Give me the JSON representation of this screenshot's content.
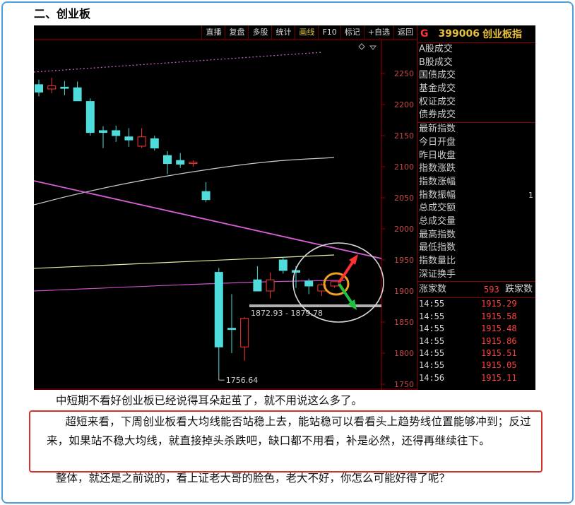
{
  "heading": "二、创业板",
  "toolbar": {
    "buttons": [
      "直播",
      "复盘",
      "多股",
      "统计",
      "画线",
      "F10",
      "标记",
      "+自选",
      "返回"
    ],
    "active": "画线"
  },
  "quote_panel": {
    "market_flag": "G",
    "code": "399006",
    "name": "创业板指",
    "group1": [
      "A股成交",
      "B股成交",
      "国债成交",
      "基金成交",
      "权证成交",
      "债券成交"
    ],
    "group2": [
      {
        "label": "最新指数",
        "value": ""
      },
      {
        "label": "今日开盘",
        "value": ""
      },
      {
        "label": "昨日收盘",
        "value": ""
      },
      {
        "label": "指数涨跌",
        "value": ""
      },
      {
        "label": "指数涨幅",
        "value": ""
      },
      {
        "label": "指数振幅",
        "value": "1"
      },
      {
        "label": "总成交额",
        "value": ""
      },
      {
        "label": "总成交量",
        "value": ""
      },
      {
        "label": "最高指数",
        "value": ""
      },
      {
        "label": "最低指数",
        "value": ""
      },
      {
        "label": "指数量比",
        "value": ""
      },
      {
        "label": "深证换手",
        "value": ""
      }
    ],
    "rise_label": "涨家数",
    "rise_count": "593",
    "fall_label": "跌家数",
    "ticks": [
      {
        "time": "14:55",
        "price": "1915.29"
      },
      {
        "time": "14:55",
        "price": "1915.58"
      },
      {
        "time": "14:55",
        "price": "1915.48"
      },
      {
        "time": "14:55",
        "price": "1915.86"
      },
      {
        "time": "14:55",
        "price": "1915.51"
      },
      {
        "time": "14:55",
        "price": "1915.05"
      },
      {
        "time": "14:56",
        "price": "1915.11"
      }
    ]
  },
  "chart": {
    "y_min": 1740,
    "y_max": 2300,
    "y_ticks": [
      1750,
      1800,
      1850,
      1900,
      1950,
      2000,
      2050,
      2100,
      2150,
      2200,
      2250
    ],
    "gap_label": "1872.93 - 1879.78",
    "low_label": "1756.64",
    "low_value": 1756.64,
    "gap_low": 1872.93,
    "gap_high": 1879.78,
    "colors": {
      "up": "#ff3333",
      "down": "#4fdcdc",
      "axis": "#a00000",
      "tick_text": "#c84a4a",
      "trend": "#d75fd7",
      "ma_long": "#c8c8c8",
      "ma_mid": "#e8e8a0",
      "ma_short": "#c850c8"
    },
    "candles": [
      {
        "o": 2232,
        "h": 2240,
        "l": 2213,
        "c": 2220
      },
      {
        "o": 2225,
        "h": 2243,
        "l": 2218,
        "c": 2230
      },
      {
        "o": 2228,
        "h": 2238,
        "l": 2215,
        "c": 2226
      },
      {
        "o": 2227,
        "h": 2237,
        "l": 2212,
        "c": 2206
      },
      {
        "o": 2205,
        "h": 2210,
        "l": 2150,
        "c": 2155
      },
      {
        "o": 2158,
        "h": 2165,
        "l": 2130,
        "c": 2155
      },
      {
        "o": 2158,
        "h": 2166,
        "l": 2140,
        "c": 2150
      },
      {
        "o": 2148,
        "h": 2162,
        "l": 2132,
        "c": 2143
      },
      {
        "o": 2133,
        "h": 2162,
        "l": 2130,
        "c": 2148
      },
      {
        "o": 2145,
        "h": 2150,
        "l": 2126,
        "c": 2130
      },
      {
        "o": 2118,
        "h": 2125,
        "l": 2088,
        "c": 2105
      },
      {
        "o": 2110,
        "h": 2122,
        "l": 2098,
        "c": 2104
      },
      {
        "o": 2105,
        "h": 2110,
        "l": 2100,
        "c": 2107
      },
      {
        "o": 2060,
        "h": 2075,
        "l": 2043,
        "c": 2047
      },
      {
        "o": 1930,
        "h": 1937,
        "l": 1765,
        "c": 1810
      },
      {
        "o": 1840,
        "h": 1895,
        "l": 1800,
        "c": 1838
      },
      {
        "o": 1810,
        "h": 1858,
        "l": 1788,
        "c": 1856
      },
      {
        "o": 1918,
        "h": 1940,
        "l": 1900,
        "c": 1900
      },
      {
        "o": 1900,
        "h": 1930,
        "l": 1888,
        "c": 1918
      },
      {
        "o": 1950,
        "h": 1955,
        "l": 1928,
        "c": 1933
      },
      {
        "o": 1933,
        "h": 1940,
        "l": 1905,
        "c": 1930
      },
      {
        "o": 1916,
        "h": 1920,
        "l": 1895,
        "c": 1908
      },
      {
        "o": 1900,
        "h": 1912,
        "l": 1892,
        "c": 1910
      },
      {
        "o": 1908,
        "h": 1912,
        "l": 1905,
        "c": 1915
      }
    ]
  },
  "paragraphs": [
    "中短期不看好创业板已经说得耳朵起茧了，就不用说这么多了。",
    "超短来看，下周创业板看大均线能否站稳上去，能站稳可以看看头上趋势线位置能够冲到；反过来，如果站不稳大均线，就直接掉头杀跌吧，缺口都不用看，补是必然，还得再继续往下。",
    "整体，就还是之前说的，看上证老大哥的脸色，老大不好，你怎么可能好得了呢？"
  ]
}
